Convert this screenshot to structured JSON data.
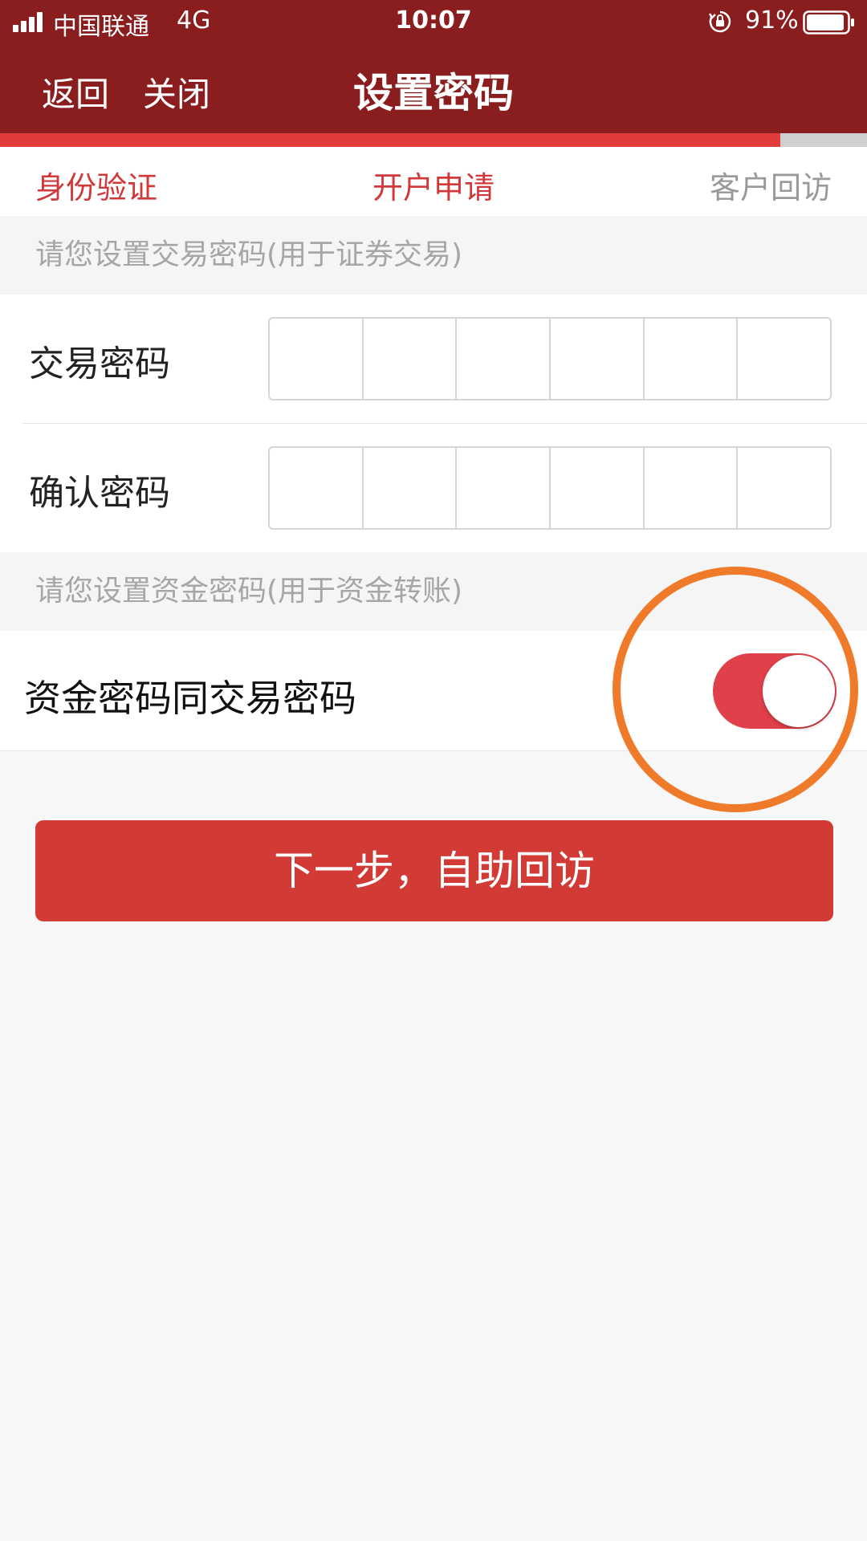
{
  "status_bar": {
    "carrier": "中国联通",
    "network": "4G",
    "time": "10:07",
    "battery_percent": "91%",
    "icons": [
      "signal-icon",
      "orientation-lock-icon",
      "battery-icon"
    ]
  },
  "header": {
    "back_label": "返回",
    "close_label": "关闭",
    "title": "设置密码"
  },
  "progress": {
    "value": 0.9
  },
  "steps": [
    {
      "label": "身份验证",
      "state": "done"
    },
    {
      "label": "开户申请",
      "state": "current"
    },
    {
      "label": "客户回访",
      "state": "pending"
    }
  ],
  "trade_password_section": {
    "hint": "请您设置交易密码(用于证券交易)",
    "fields": [
      {
        "label": "交易密码",
        "digits": 6,
        "value": ""
      },
      {
        "label": "确认密码",
        "digits": 6,
        "value": ""
      }
    ]
  },
  "fund_password_section": {
    "hint": "请您设置资金密码(用于资金转账)",
    "toggle_label": "资金密码同交易密码",
    "toggle_on": true
  },
  "next_button_label": "下一步，自助回访",
  "colors": {
    "header_bg": "#8a1e1f",
    "accent_red": "#e23b3b",
    "button_red": "#d23a35",
    "step_active": "#d0383a",
    "step_pending": "#999999",
    "highlight_orange": "#ee7a2a"
  }
}
